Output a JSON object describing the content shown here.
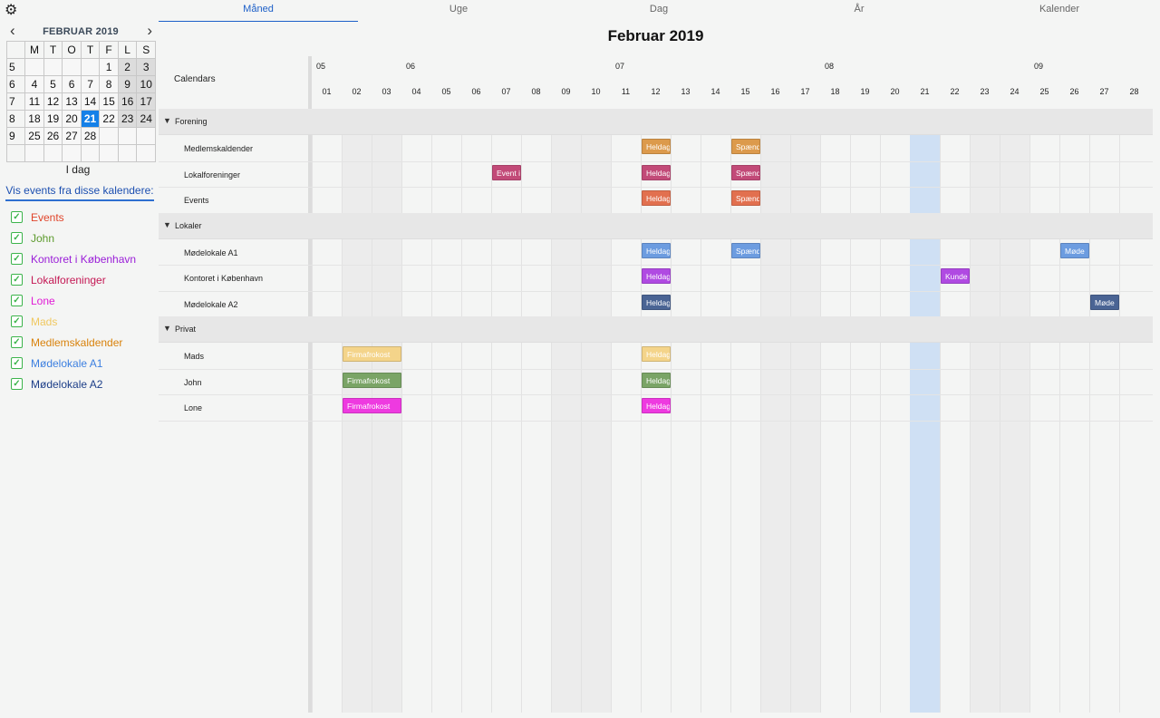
{
  "tabs": [
    "Måned",
    "Uge",
    "Dag",
    "År",
    "Kalender"
  ],
  "active_tab": 0,
  "title": "Februar 2019",
  "mini_calendar": {
    "title": "FEBRUAR 2019",
    "prev": "‹",
    "next": "›",
    "weekdays": [
      "M",
      "T",
      "O",
      "T",
      "F",
      "L",
      "S"
    ],
    "weeks": [
      {
        "wk": "5",
        "days": [
          "",
          "",
          "",
          "",
          "1",
          "2",
          "3"
        ]
      },
      {
        "wk": "6",
        "days": [
          "4",
          "5",
          "6",
          "7",
          "8",
          "9",
          "10"
        ]
      },
      {
        "wk": "7",
        "days": [
          "11",
          "12",
          "13",
          "14",
          "15",
          "16",
          "17"
        ]
      },
      {
        "wk": "8",
        "days": [
          "18",
          "19",
          "20",
          "21",
          "22",
          "23",
          "24"
        ]
      },
      {
        "wk": "9",
        "days": [
          "25",
          "26",
          "27",
          "28",
          "",
          "",
          ""
        ]
      },
      {
        "wk": "",
        "days": [
          "",
          "",
          "",
          "",
          "",
          "",
          ""
        ]
      }
    ],
    "today": "21"
  },
  "today_label": "I dag",
  "calendars_heading": "Vis events fra disse kalendere:",
  "calendars": [
    {
      "name": "Events",
      "color": "#e0442a"
    },
    {
      "name": "John",
      "color": "#5c9a2c"
    },
    {
      "name": "Kontoret i København",
      "color": "#9a1ed8"
    },
    {
      "name": "Lokalforeninger",
      "color": "#c41854"
    },
    {
      "name": "Lone",
      "color": "#e01ad6"
    },
    {
      "name": "Mads",
      "color": "#f0c860"
    },
    {
      "name": "Medlemskaldender",
      "color": "#d9820c"
    },
    {
      "name": "Mødelokale A1",
      "color": "#3c7fe0"
    },
    {
      "name": "Mødelokale A2",
      "color": "#1c3e88"
    }
  ],
  "grid": {
    "calendars_label": "Calendars",
    "weeks": [
      "05",
      "06",
      "07",
      "08",
      "09"
    ],
    "days": [
      "01",
      "02",
      "03",
      "04",
      "05",
      "06",
      "07",
      "08",
      "09",
      "10",
      "11",
      "12",
      "13",
      "14",
      "15",
      "16",
      "17",
      "18",
      "19",
      "20",
      "21",
      "22",
      "23",
      "24",
      "25",
      "26",
      "27",
      "28"
    ],
    "today": "21",
    "groups": [
      {
        "name": "Forening",
        "rows": [
          {
            "name": "Medlemskaldender",
            "events": [
              {
                "label": "Heldag",
                "day": "12",
                "length": 1,
                "color": "#dc9a4c"
              },
              {
                "label": "Spænd",
                "day": "15",
                "length": 1,
                "color": "#dc9a4c"
              }
            ]
          },
          {
            "name": "Lokalforeninger",
            "events": [
              {
                "label": "Event i",
                "day": "07",
                "length": 1,
                "color": "#c24a78"
              },
              {
                "label": "Heldag",
                "day": "12",
                "length": 1,
                "color": "#c24a78"
              },
              {
                "label": "Spænd",
                "day": "15",
                "length": 1,
                "color": "#c24a78"
              }
            ]
          },
          {
            "name": "Events",
            "events": [
              {
                "label": "Heldag",
                "day": "12",
                "length": 1,
                "color": "#e2704f"
              },
              {
                "label": "Spænd",
                "day": "15",
                "length": 1,
                "color": "#e2704f"
              }
            ]
          }
        ]
      },
      {
        "name": "Lokaler",
        "rows": [
          {
            "name": "Mødelokale A1",
            "events": [
              {
                "label": "Heldag",
                "day": "12",
                "length": 1,
                "color": "#6c9ce0"
              },
              {
                "label": "Spænd",
                "day": "15",
                "length": 1,
                "color": "#6c9ce0"
              },
              {
                "label": "Møde",
                "day": "26",
                "length": 1,
                "color": "#6c9ce0"
              }
            ]
          },
          {
            "name": "Kontoret i København",
            "events": [
              {
                "label": "Heldag",
                "day": "12",
                "length": 1,
                "color": "#b04ae2"
              },
              {
                "label": "Kunde",
                "day": "22",
                "length": 1,
                "color": "#b04ae2"
              }
            ]
          },
          {
            "name": "Mødelokale A2",
            "events": [
              {
                "label": "Heldag",
                "day": "12",
                "length": 1,
                "color": "#4a6494"
              },
              {
                "label": "Møde",
                "day": "27",
                "length": 1,
                "color": "#4a6494"
              }
            ]
          }
        ]
      },
      {
        "name": "Privat",
        "rows": [
          {
            "name": "Mads",
            "events": [
              {
                "label": "Firmafrokost",
                "day": "02",
                "length": 2,
                "color": "#f4d48a"
              },
              {
                "label": "Heldag",
                "day": "12",
                "length": 1,
                "color": "#f4d48a"
              }
            ]
          },
          {
            "name": "John",
            "events": [
              {
                "label": "Firmafrokost",
                "day": "02",
                "length": 2,
                "color": "#7aa466"
              },
              {
                "label": "Heldag",
                "day": "12",
                "length": 1,
                "color": "#7aa466"
              }
            ]
          },
          {
            "name": "Lone",
            "events": [
              {
                "label": "Firmafrokost",
                "day": "02",
                "length": 2,
                "color": "#ee3ae0"
              },
              {
                "label": "Heldag",
                "day": "12",
                "length": 1,
                "color": "#ee3ae0"
              }
            ]
          }
        ]
      }
    ]
  }
}
